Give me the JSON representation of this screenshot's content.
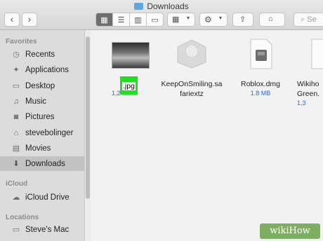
{
  "window": {
    "title": "Downloads"
  },
  "toolbar": {
    "back": "‹",
    "forward": "›",
    "search_placeholder": "Se"
  },
  "sidebar": {
    "favorites_header": "Favorites",
    "favorites": [
      {
        "label": "Recents",
        "icon": "clock-icon"
      },
      {
        "label": "Applications",
        "icon": "applications-icon"
      },
      {
        "label": "Desktop",
        "icon": "desktop-icon"
      },
      {
        "label": "Music",
        "icon": "music-icon"
      },
      {
        "label": "Pictures",
        "icon": "camera-icon"
      },
      {
        "label": "stevebolinger",
        "icon": "home-icon"
      },
      {
        "label": "Movies",
        "icon": "film-icon"
      },
      {
        "label": "Downloads",
        "icon": "download-icon",
        "selected": true
      }
    ],
    "icloud_header": "iCloud",
    "icloud": [
      {
        "label": "iCloud Drive",
        "icon": "cloud-icon"
      }
    ],
    "locations_header": "Locations",
    "locations": [
      {
        "label": "Steve's Mac",
        "icon": "computer-icon"
      }
    ]
  },
  "files": [
    {
      "name_edit": ".jpg",
      "size": "1,2"
    },
    {
      "name": "KeepOnSmiling.sa",
      "name2": "fariextz",
      "size": ""
    },
    {
      "name": "Roblox.dmg",
      "size": "1.8 MB"
    },
    {
      "name": "Wikiho",
      "name2": "Green.",
      "size": "1,3"
    }
  ],
  "watermark": "wikiHow",
  "colors": {
    "rename_highlight": "#1fe01f",
    "size_text": "#2a6ad2",
    "selected_sidebar": "#c2c2c2"
  }
}
